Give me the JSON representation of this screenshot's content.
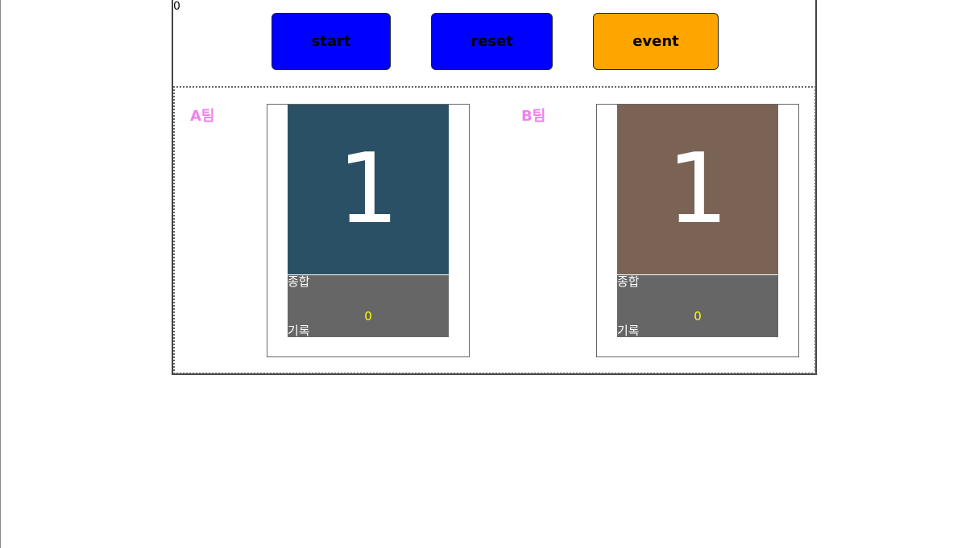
{
  "counter": "0",
  "controls": {
    "start_label": "start",
    "reset_label": "reset",
    "event_label": "event"
  },
  "teams": [
    {
      "name": "A팀",
      "score": "1",
      "total_label": "종합",
      "record_label": "기록",
      "record_value": "0",
      "color": "#2a5066"
    },
    {
      "name": "B팀",
      "score": "1",
      "total_label": "종합",
      "record_label": "기록",
      "record_value": "0",
      "color": "#7a6355"
    }
  ],
  "colors": {
    "start_button": "#0000ff",
    "reset_button": "#0000ff",
    "event_button": "#ffa500",
    "team_label": "#ee82ee",
    "record_background": "#666666",
    "record_value": "#ffff00"
  }
}
